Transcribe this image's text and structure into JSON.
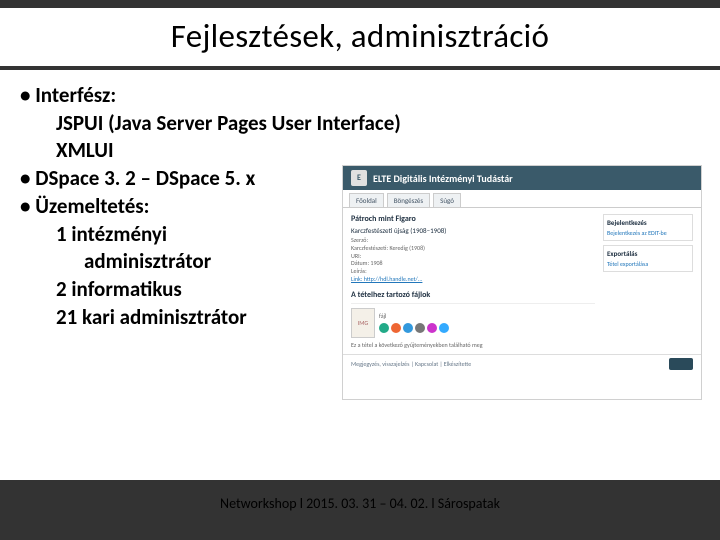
{
  "title": "Fejlesztések, adminisztráció",
  "bullets": {
    "b1": "• Interfész:",
    "b1a": "JSPUI (Java Server Pages User Interface)",
    "b1b": "XMLUI",
    "b2": "• DSpace 3. 2 – DSpace 5. x",
    "b3": "• Üzemeltetés:",
    "b3a": "1 intézményi",
    "b3a2": "adminisztrátor",
    "b3b": "2 informatikus",
    "b3c": "21 kari adminisztrátor"
  },
  "footer": "Networkshop l  2015. 03. 31 – 04. 02.  l Sárospatak",
  "shot": {
    "brand": "ELTE Digitális Intézményi Tudástár",
    "tabs": [
      "Főoldal",
      "Böngészés",
      "Súgó"
    ],
    "item_title": "Pátroch mint Figaro",
    "item_sub": "Karczfestészeti újság (1908–1908)",
    "meta_lines": [
      "Szerző:",
      "Karczfestészeti: Keredig (1908)",
      "URI:",
      "Dátum: 1908",
      "Leírás:",
      "Link: http://hdl.handle.net/..."
    ],
    "section": "A tételhez tartozó fájlok",
    "note": "Ez a tétel a következő gyűjteményekben található meg",
    "right": {
      "login_title": "Bejelentkezés",
      "login_link": "Bejelentkezés az EDIT-be",
      "export_title": "Exportálás",
      "export_link": "Tétel exportálása"
    },
    "footer": "Megjegyzés, visszajelzés | Kapcsolat | Elkészítette",
    "chips": [
      "#2a8",
      "#e63",
      "#39d",
      "#777",
      "#c3c",
      "#3af"
    ]
  }
}
